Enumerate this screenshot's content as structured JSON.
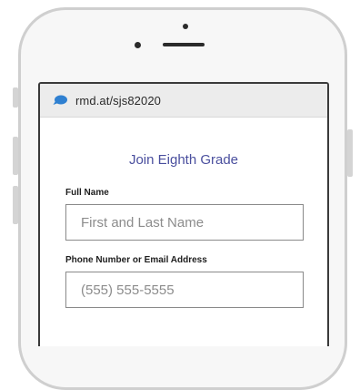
{
  "browser": {
    "url": "rmd.at/sjs82020",
    "site_icon": "chat-bubble-icon",
    "icon_color": "#2f80d1"
  },
  "form": {
    "title": "Join Eighth Grade",
    "title_color": "#4a4f9e",
    "full_name": {
      "label": "Full Name",
      "placeholder": "First and Last Name",
      "value": ""
    },
    "contact": {
      "label": "Phone Number or Email Address",
      "placeholder": "(555) 555-5555",
      "value": ""
    }
  }
}
